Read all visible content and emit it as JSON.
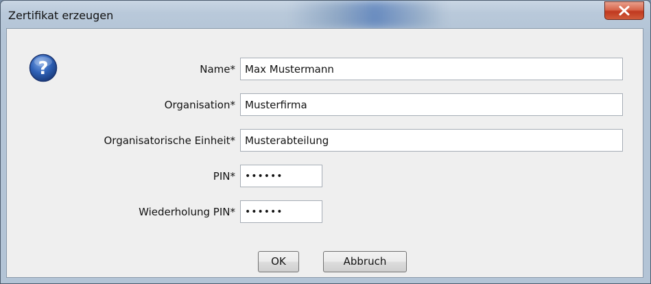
{
  "window": {
    "title": "Zertifikat erzeugen"
  },
  "icon": {
    "name": "question-icon",
    "glyph": "?",
    "color": "#2a5aa8"
  },
  "form": {
    "name_label": "Name*",
    "name_value": "Max Mustermann",
    "organisation_label": "Organisation*",
    "organisation_value": "Musterfirma",
    "unit_label": "Organisatorische Einheit*",
    "unit_value": "Musterabteilung",
    "pin_label": "PIN*",
    "pin_value": "••••••",
    "pin_repeat_label": "Wiederholung PIN*",
    "pin_repeat_value": "••••••"
  },
  "buttons": {
    "ok_label": "OK",
    "cancel_label": "Abbruch"
  },
  "colors": {
    "close_button": "#c0391f",
    "dialog_background": "#efefef"
  }
}
